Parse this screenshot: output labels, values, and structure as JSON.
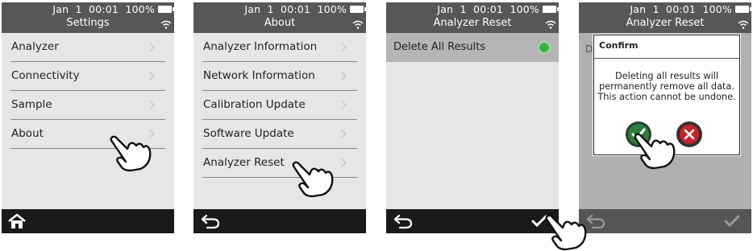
{
  "status": {
    "date_time": "Jan  1  00:01",
    "battery": "100%"
  },
  "screens": [
    {
      "title": "Settings",
      "items": [
        {
          "label": "Analyzer"
        },
        {
          "label": "Connectivity"
        },
        {
          "label": "Sample"
        },
        {
          "label": "About"
        }
      ],
      "bottom_icon": "home-icon"
    },
    {
      "title": "About",
      "items": [
        {
          "label": "Analyzer Information"
        },
        {
          "label": "Network Information"
        },
        {
          "label": "Calibration Update"
        },
        {
          "label": "Software Update"
        },
        {
          "label": "Analyzer Reset"
        }
      ],
      "bottom_icon": "back-arrow-icon"
    },
    {
      "title": "Analyzer Reset",
      "row": {
        "label": "Delete All Results",
        "selected_color": "#3db14a"
      },
      "bottom_icons": [
        "back-arrow-icon",
        "checkmark-icon"
      ]
    },
    {
      "title": "Analyzer Reset",
      "dim_label": "D",
      "dialog": {
        "title": "Confirm",
        "message": "Deleting all results will\npermanently remove all data.\nThis action cannot be undone.",
        "confirm_icon": "checkmark-button-icon",
        "cancel_icon": "close-button-icon"
      },
      "bottom_icons": [
        "back-arrow-icon",
        "checkmark-icon"
      ]
    }
  ],
  "colors": {
    "top_bar": "#575757",
    "bottom_bar": "#1a1a1a",
    "background": "#e6e6e6",
    "confirm_green": "#2f7d3a",
    "cancel_red": "#c0272d"
  }
}
